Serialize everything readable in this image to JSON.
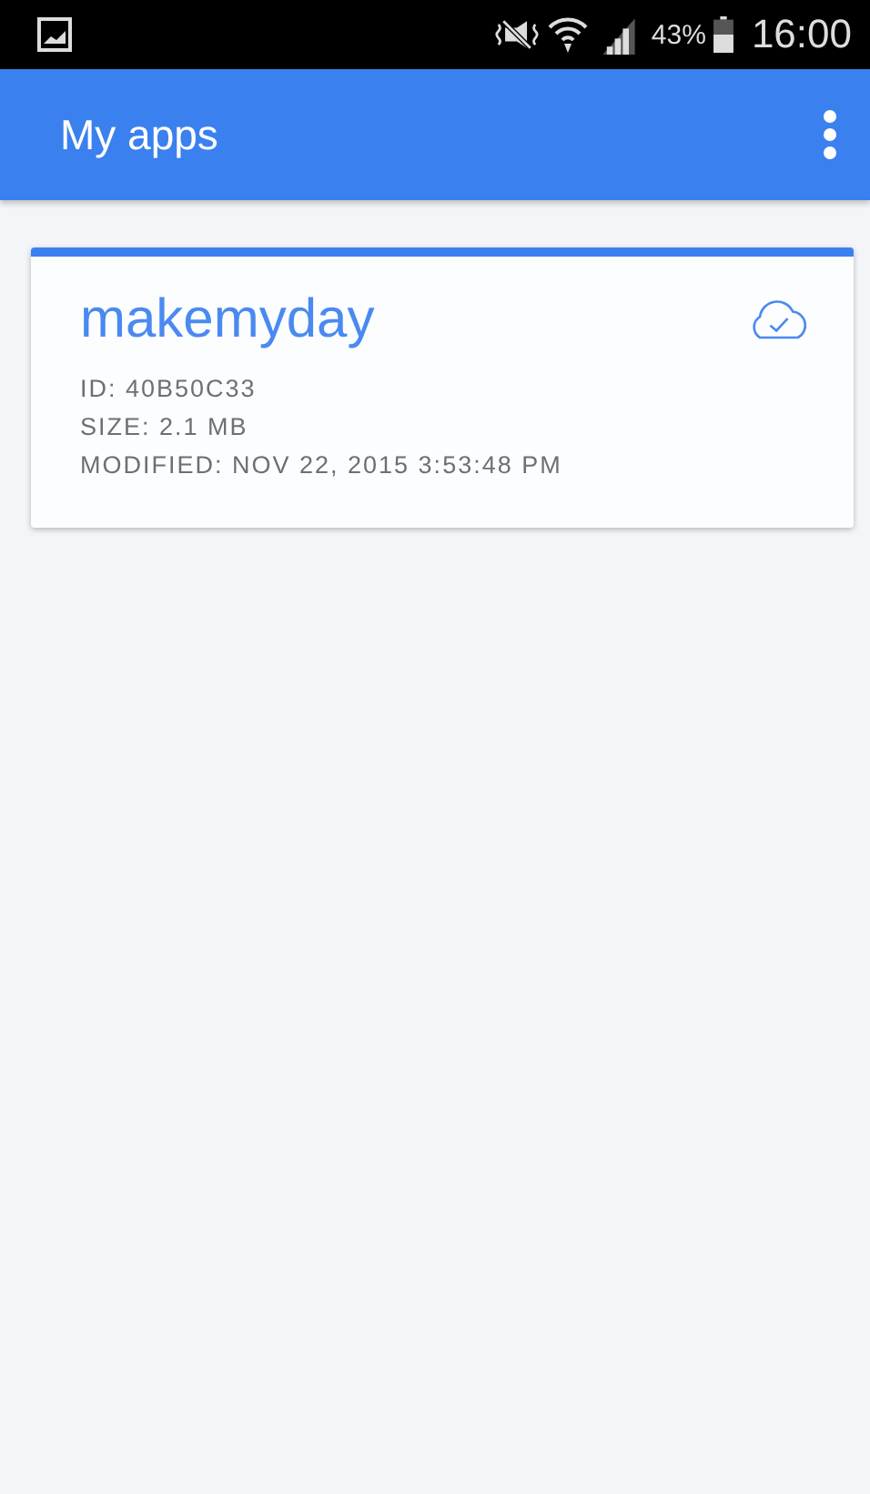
{
  "status_bar": {
    "battery": "43%",
    "time": "16:00"
  },
  "app_bar": {
    "title": "My apps"
  },
  "apps": [
    {
      "name": "makemyday",
      "synced": true,
      "details": [
        "ID: 40B50C33",
        "SIZE: 2.1 MB",
        "MODIFIED: NOV 22, 2015 3:53:48 PM"
      ]
    }
  ]
}
